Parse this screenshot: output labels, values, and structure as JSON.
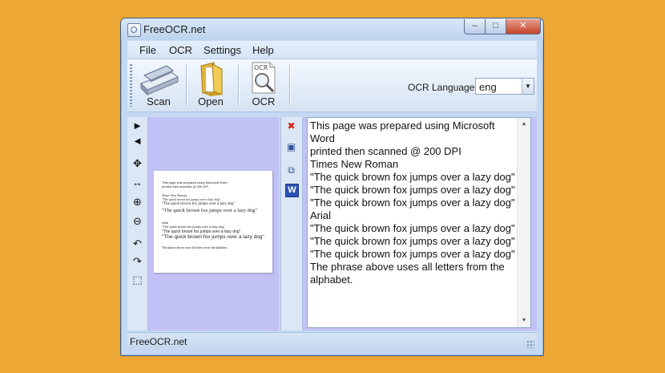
{
  "window": {
    "title": "FreeOCR.net",
    "controls": {
      "minimize": "–",
      "maximize": "□",
      "close": "✕"
    }
  },
  "menu": {
    "items": [
      "File",
      "OCR",
      "Settings",
      "Help"
    ]
  },
  "toolbar": {
    "scan_label": "Scan",
    "open_label": "Open",
    "ocr_label": "OCR",
    "ocr_icon_text": "OCR",
    "language_label": "OCR Language",
    "language_value": "eng"
  },
  "left_tools": {
    "items": [
      {
        "name": "next-page-icon",
        "glyph": "►"
      },
      {
        "name": "previous-page-icon",
        "glyph": "◄"
      },
      {
        "name": "move-icon",
        "glyph": "✥"
      },
      {
        "name": "fit-width-icon",
        "glyph": "↔"
      },
      {
        "name": "zoom-in-icon",
        "glyph": "⊕"
      },
      {
        "name": "zoom-out-icon",
        "glyph": "⊖"
      },
      {
        "name": "rotate-left-icon",
        "glyph": "↶"
      },
      {
        "name": "rotate-right-icon",
        "glyph": "↷"
      },
      {
        "name": "select-area-icon",
        "glyph": "⬚"
      }
    ]
  },
  "preview": {
    "lines": [
      "This page was prepared using Microsoft Word",
      "printed then scanned @ 200 DPI",
      "Times New Roman",
      "\"The quick brown fox jumps over a lazy dog\"",
      "\"The quick brown fox jumps over a lazy dog\"",
      "\"The quick brown fox jumps over a lazy dog\"",
      "Arial",
      "\"The quick brown fox jumps over a lazy dog\"",
      "\"The quick brown fox jumps over a lazy dog\"",
      "\"The quick brown fox jumps over a lazy dog\"",
      "The phrase above uses all letters from the alphabet."
    ]
  },
  "mid_tools": {
    "items": [
      {
        "name": "clear-icon",
        "glyph": "✖",
        "color": "#D7261E"
      },
      {
        "name": "save-icon",
        "glyph": "▣",
        "color": "#2F4E9A"
      },
      {
        "name": "copy-icon",
        "glyph": "⧉",
        "color": "#2F4E9A"
      },
      {
        "name": "word-icon",
        "glyph": "W",
        "color": "#FFFFFF"
      }
    ]
  },
  "result": {
    "lines": [
      "This page was prepared using Microsoft",
      "Word",
      "printed then scanned @ 200 DPI",
      "Times New Roman",
      "\"The quick brown fox jumps over a lazy dog\"",
      "\"The quick brown fox jumps over a lazy dog\"",
      "\"The quick brown fox jumps over a lazy dog\"",
      "Arial",
      "\"The quick brown fox jumps over a lazy dog\"",
      "\"The quick brown fox jumps over a lazy dog\"",
      "\"The quick brown fox jumps over a lazy dog\"",
      "The phrase above uses all letters from the",
      "alphabet."
    ]
  },
  "status": {
    "text": "FreeOCR.net"
  },
  "colors": {
    "background": "#EDA734",
    "pane_background": "#C2C1F5",
    "window_frame": "#C4D9F1"
  }
}
